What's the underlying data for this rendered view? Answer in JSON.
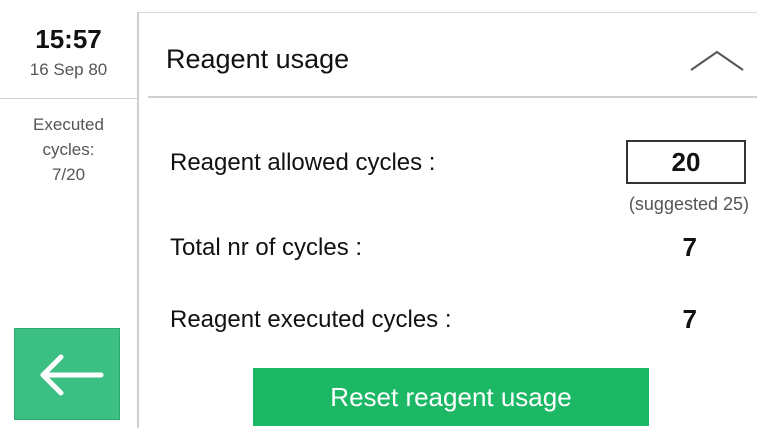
{
  "sidebar": {
    "time": "15:57",
    "date": "16 Sep 80",
    "executed_label": "Executed cycles:",
    "executed_value": "7/20",
    "back_icon": "arrow-left-icon"
  },
  "header": {
    "title": "Reagent usage",
    "collapse_icon": "chevron-up-icon"
  },
  "rows": {
    "allowed_label": "Reagent allowed cycles :",
    "allowed_value": "20",
    "suggested": "(suggested 25)",
    "total_label": "Total nr of cycles :",
    "total_value": "7",
    "executed_label": "Reagent executed cycles :",
    "executed_value": "7"
  },
  "actions": {
    "reset_label": "Reset reagent usage"
  },
  "colors": {
    "accent_green": "#1db865",
    "back_button_green": "#3cbf82"
  }
}
